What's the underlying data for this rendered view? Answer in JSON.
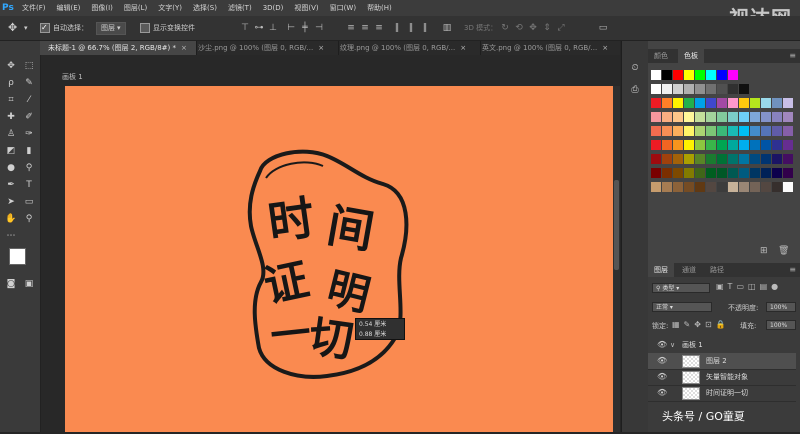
{
  "app": {
    "logo": "Ps"
  },
  "menu": [
    "文件(F)",
    "编辑(E)",
    "图像(I)",
    "图层(L)",
    "文字(Y)",
    "选择(S)",
    "滤镜(T)",
    "3D(D)",
    "视图(V)",
    "窗口(W)",
    "帮助(H)"
  ],
  "watermark_top": "视达网",
  "options": {
    "move_icon": "move-tool-icon",
    "auto_select_label": "自动选择：",
    "auto_select_checked": true,
    "auto_select_target": "图层",
    "show_transform_label": "显示变换控件",
    "mode_3d_label": "3D 模式："
  },
  "tabs": [
    {
      "label": "未标题-1 @ 66.7% (图层 2, RGB/8#) *",
      "active": true
    },
    {
      "label": "沙尘.png @ 100% (图层 0, RGB/...",
      "active": false
    },
    {
      "label": "纹理.png @ 100% (图层 0, RGB/...",
      "active": false
    },
    {
      "label": "英文.png @ 100% (图层 0, RGB/...",
      "active": false
    }
  ],
  "artboard_label": "画板 1",
  "canvas": {
    "color": "#fa8a50",
    "art_text": [
      "时",
      "间",
      "证",
      "明",
      "一",
      "切"
    ]
  },
  "tooltip": {
    "line1": "0.54 厘米",
    "line2": "0.88 厘米"
  },
  "color_panel": {
    "tabs": [
      "颜色",
      "色板"
    ],
    "active_tab": "色板"
  },
  "layers_panel": {
    "tabs": [
      "图层",
      "通道",
      "路径"
    ],
    "filter_label": "类型",
    "blend_mode": "正常",
    "opacity_label": "不透明度:",
    "opacity": "100%",
    "lock_label": "锁定:",
    "fill_label": "填充:",
    "fill": "100%",
    "layers": [
      {
        "name": "画板 1",
        "type": "artboard",
        "selected": false
      },
      {
        "name": "图层 2",
        "type": "layer",
        "selected": true
      },
      {
        "name": "矢量智能对象",
        "type": "smart",
        "selected": false
      },
      {
        "name": "时间证明一切",
        "type": "layer",
        "selected": false
      }
    ]
  },
  "watermark_bottom": "头条号 / GO童夏"
}
